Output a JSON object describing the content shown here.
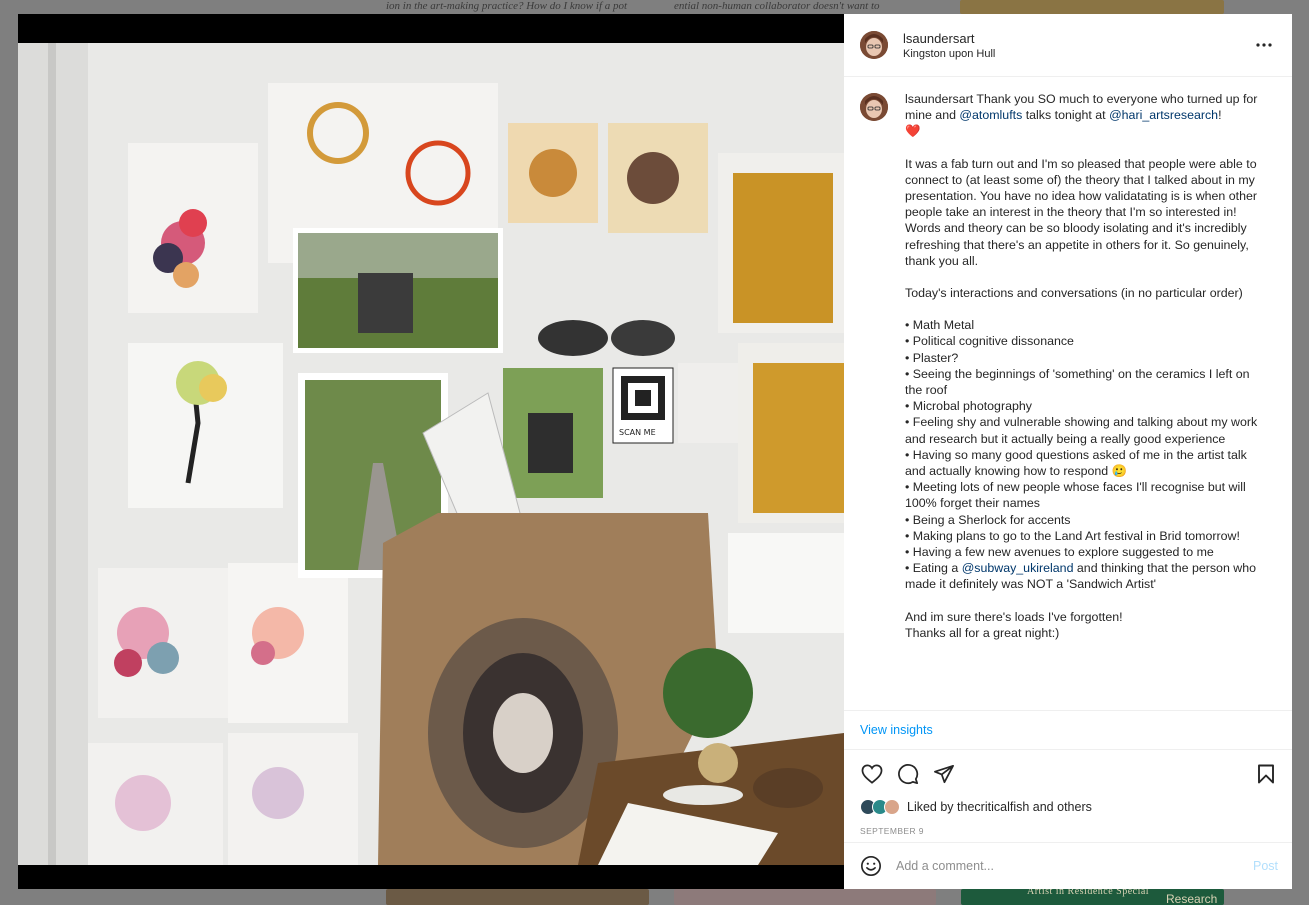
{
  "background": {
    "text_left": "ion in the art-making practice? How do I know if a pot",
    "text_right": "ential non-human collaborator doesn't want to",
    "banner_small": "Artist in Residence Special",
    "banner_large": "Research"
  },
  "post": {
    "username": "lsaundersart",
    "location": "Kingston upon Hull",
    "caption": {
      "username": "lsaundersart",
      "intro_a": " Thank you SO much to everyone who turned up for mine and ",
      "mention_1": "@atomlufts",
      "intro_b": " talks tonight at ",
      "mention_2": "@hari_artsresearch",
      "intro_c": "!",
      "heart": "❤️",
      "para1": "It was a fab turn out and I'm so pleased that people were able to connect to (at least some of) the theory that I talked about in my presentation. You have no idea how validatating is is when other people take an interest in the theory that I'm so interested in! Words and theory can be so bloody isolating and it's incredibly refreshing that there's an appetite in others for it. So genuinely, thank you all.",
      "para2": "Today's interactions and conversations (in no particular order)",
      "bullets": [
        "• Math Metal",
        "• Political cognitive dissonance",
        "• Plaster?",
        "• Seeing the beginnings of 'something' on the ceramics I left on the roof",
        "• Microbal photography",
        "• Feeling shy and vulnerable showing and talking about my work and research but it actually being a really good experience",
        "• Having so many good questions asked of me in the artist talk and actually knowing how to respond 🥲",
        "• Meeting lots of new people whose faces I'll recognise but will 100% forget their names",
        "• Being a Sherlock for accents",
        "• Making plans to go to the Land Art festival in Brid tomorrow!",
        "• Having a few new avenues to explore suggested to me"
      ],
      "bullet_last_a": "• Eating a ",
      "bullet_last_mention": "@subway_ukireland",
      "bullet_last_b": " and thinking that the person who made it definitely was NOT a 'Sandwich Artist'",
      "closing1": "And im sure there's loads I've forgotten!",
      "closing2": "Thanks all for a great night:)"
    },
    "insights_label": "View insights",
    "likes": {
      "prefix": "Liked by",
      "user": "thecriticalfish",
      "middle": "and",
      "others": "others"
    },
    "date": "SEPTEMBER 9",
    "comment_placeholder": "Add a comment...",
    "post_label": "Post"
  },
  "photo": {
    "scan_label": "SCAN ME"
  },
  "icons": {
    "more": "more-options-icon",
    "like": "heart-icon",
    "comment": "comment-icon",
    "share": "share-icon",
    "save": "bookmark-icon",
    "emoji": "emoji-icon"
  },
  "colors": {
    "link": "#0095f6",
    "mention": "#00376b",
    "post_disabled": "#b2dffc",
    "heart": "#e0245e"
  }
}
